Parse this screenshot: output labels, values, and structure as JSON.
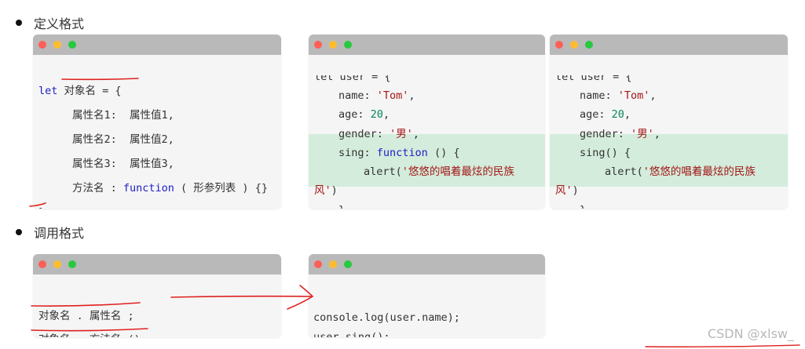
{
  "section1": {
    "title": "定义格式"
  },
  "section2": {
    "title": "调用格式"
  },
  "win_define": {
    "l1_kw": "let",
    "l1_name": "对象名",
    "l1_rest": " = {",
    "l2": "属性名1:  属性值1,",
    "l3": "属性名2:  属性值2,",
    "l4": "属性名3:  属性值3,",
    "l5_a": "方法名 : ",
    "l5_kw": "function",
    "l5_b": " ( 形参列表 ) {}",
    "l6": "}"
  },
  "win_example1": {
    "top": "let user = {",
    "name_key": "name: ",
    "name_val": "'Tom'",
    "name_end": ",",
    "age_key": "age: ",
    "age_val": "20",
    "age_end": ",",
    "gender_key": "gender: ",
    "gender_val": "'男'",
    "gender_end": ",",
    "sing_key": "sing: ",
    "sing_kw": "function",
    "sing_rest": " () {",
    "alert_a": "alert(",
    "alert_str": "'悠悠的唱着最炫的民族",
    "alert_wrap_str": "风'",
    "alert_wrap_end": ")",
    "close_inner": "}",
    "close": "}"
  },
  "win_example2": {
    "top": "let user = {",
    "name_key": "name: ",
    "name_val": "'Tom'",
    "name_end": ",",
    "age_key": "age: ",
    "age_val": "20",
    "age_end": ",",
    "gender_key": "gender: ",
    "gender_val": "'男'",
    "gender_end": ",",
    "sing": "sing() {",
    "alert_a": "alert(",
    "alert_str": "'悠悠的唱着最炫的民族",
    "alert_wrap_str": "风'",
    "alert_wrap_end": ")",
    "close_inner": "}",
    "close": "}"
  },
  "win_call": {
    "l1": "对象名 . 属性名 ;",
    "l2": "对象名 . 方法名 ();"
  },
  "win_call_example": {
    "l1": "console.log(user.name);",
    "l2": "user.sing();"
  },
  "watermark": "CSDN @xlsw_",
  "colors": {
    "titlebar": "#b9b9b9",
    "keyword": "#1c1cc8",
    "string": "#a31515",
    "number": "#098658",
    "highlight": "#d3ecdc",
    "annotation": "#e02020"
  }
}
